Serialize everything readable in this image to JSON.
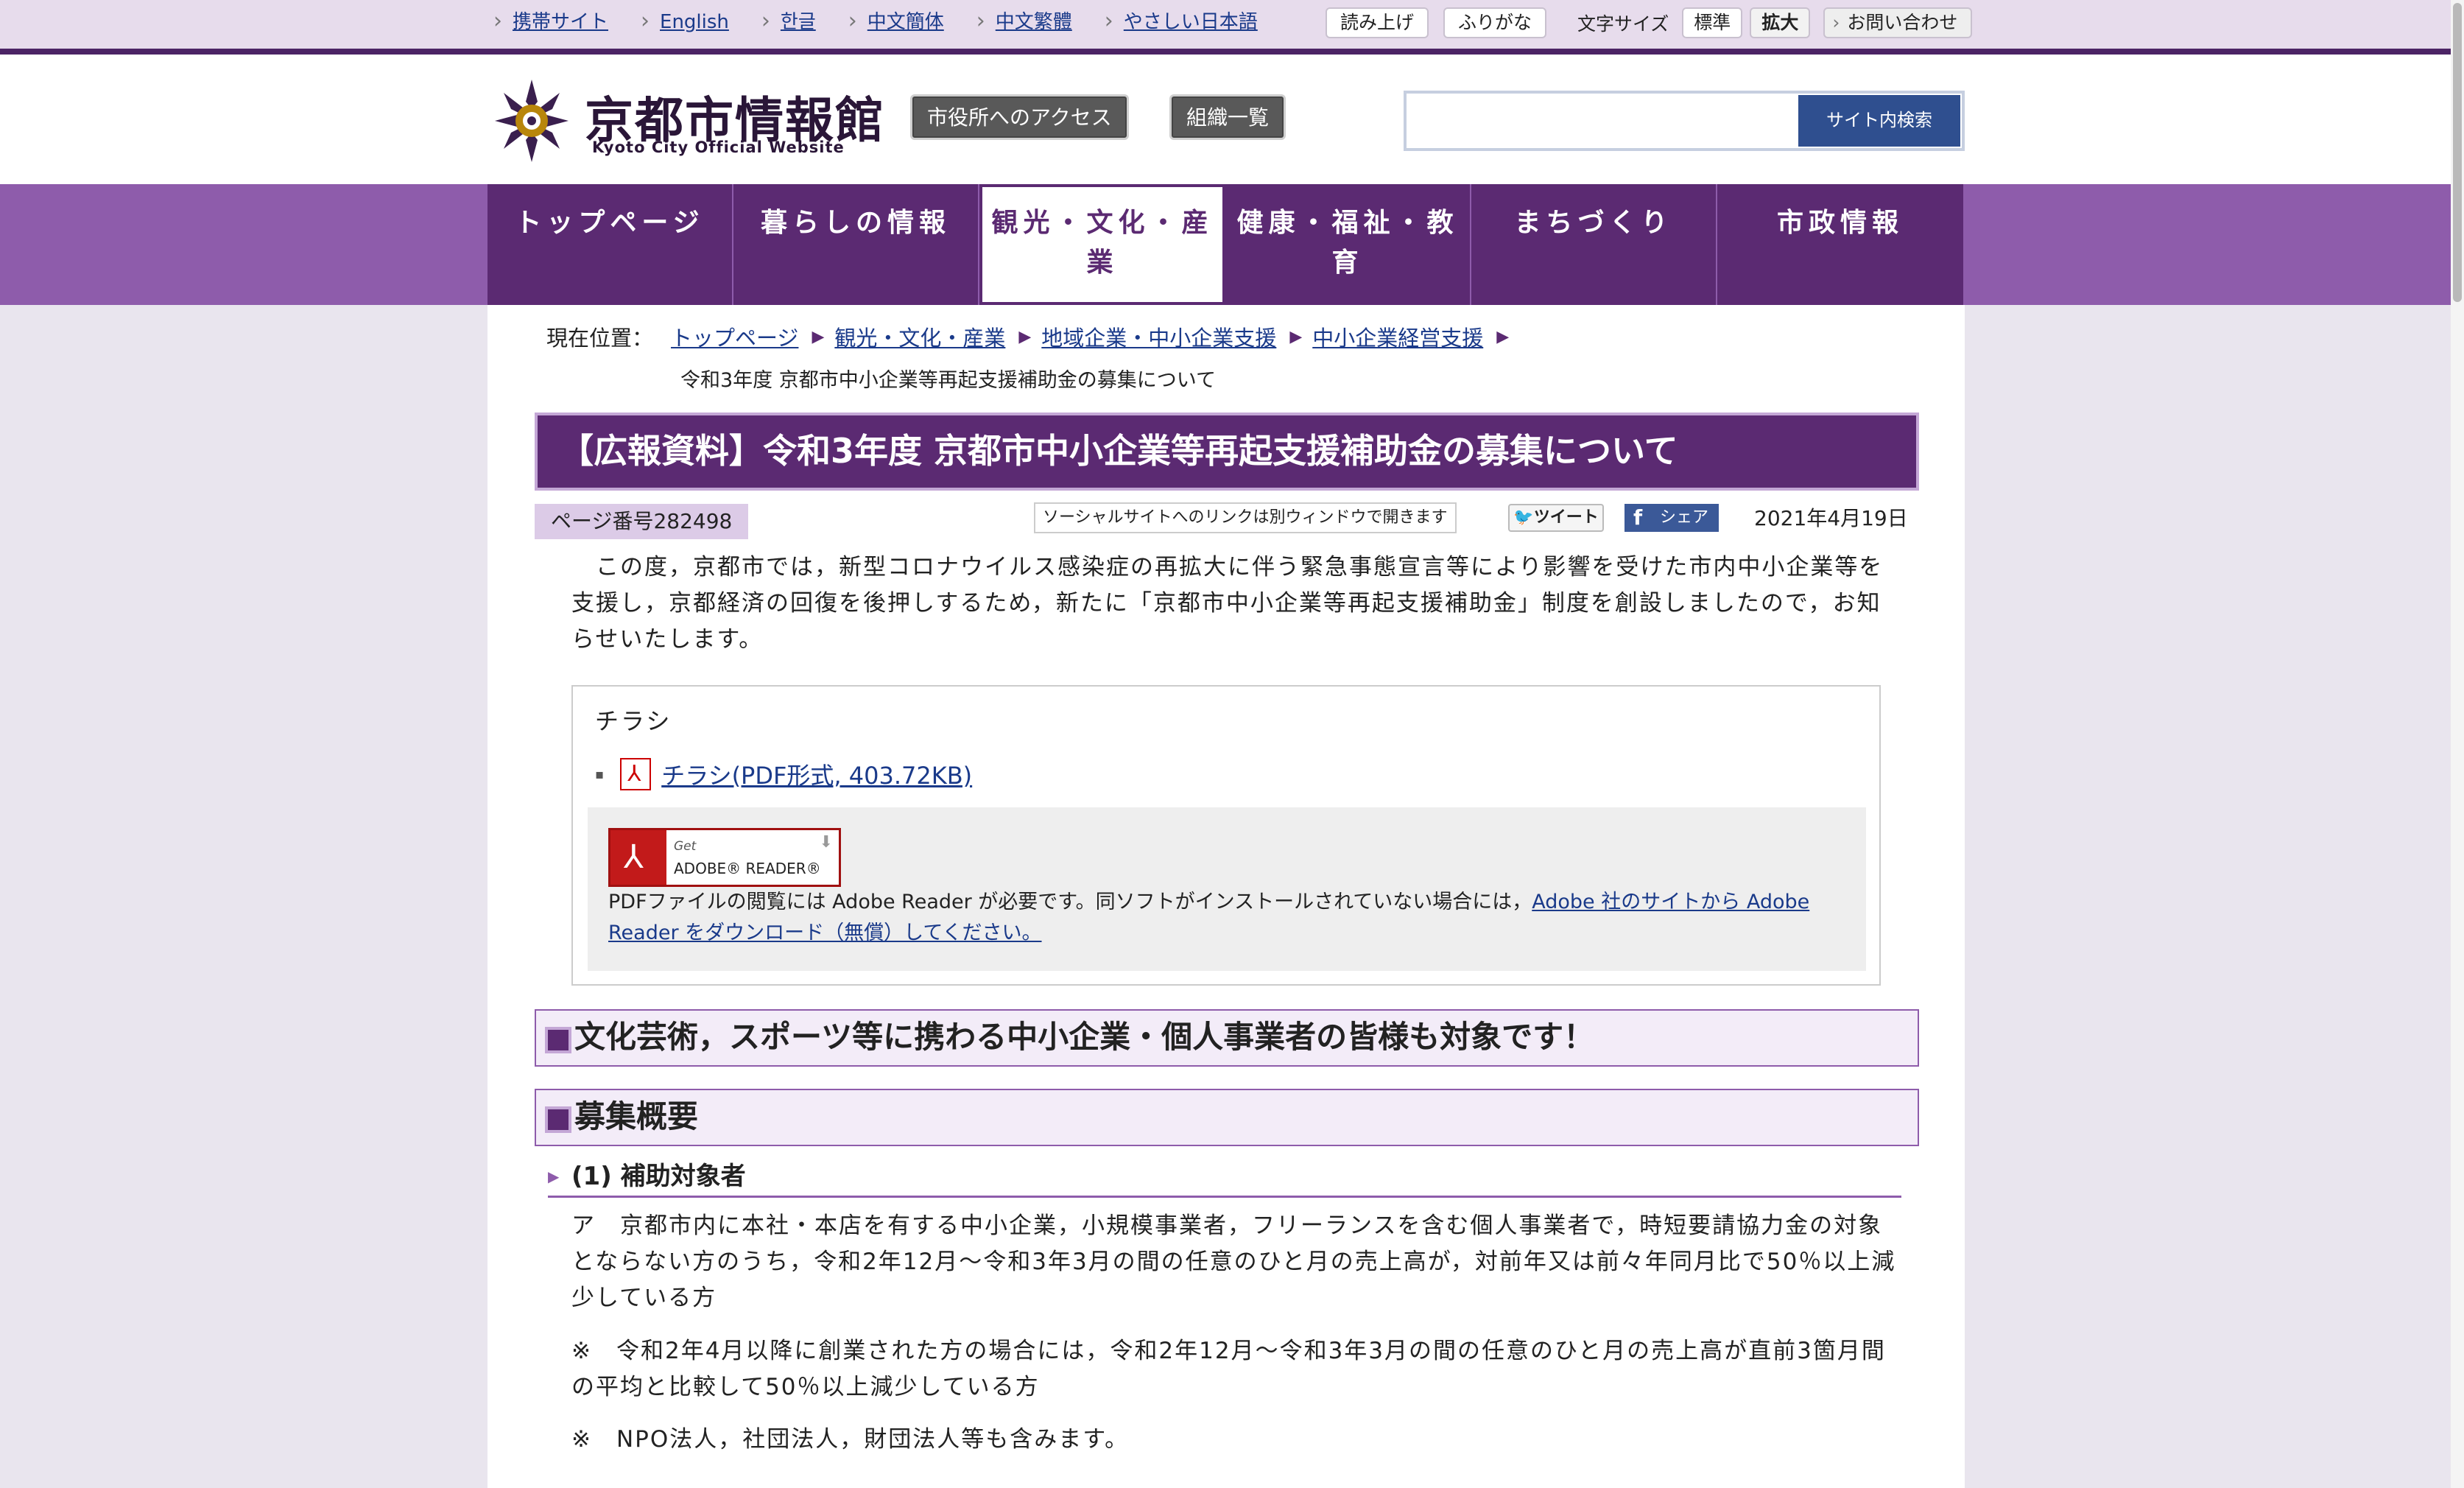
{
  "util": {
    "langs": [
      "携帯サイト",
      "English",
      "한글",
      "中文簡体",
      "中文繁體",
      "やさしい日本語"
    ],
    "read_aloud": "読み上げ",
    "furigana": "ふりがな",
    "font_size_label": "文字サイズ",
    "font_standard": "標準",
    "font_large": "拡大",
    "contact": "お問い合わせ"
  },
  "header": {
    "logo_title": "京都市情報館",
    "logo_sub": "Kyoto City Official Website",
    "access_btn": "市役所へのアクセス",
    "org_btn": "組織一覧",
    "search_placeholder": "",
    "search_btn": "サイト内検索"
  },
  "nav": [
    "トップページ",
    "暮らしの情報",
    "観光・文化・産業",
    "健康・福祉・教育",
    "まちづくり",
    "市政情報"
  ],
  "breadcrumb": {
    "label": "現在位置：",
    "links": [
      "トップページ",
      "観光・文化・産業",
      "地域企業・中小企業支援",
      "中小企業経営支援"
    ],
    "current": "令和3年度 京都市中小企業等再起支援補助金の募集について"
  },
  "article": {
    "title": "【広報資料】令和3年度 京都市中小企業等再起支援補助金の募集について",
    "page_no": "ページ番号282498",
    "social_note": "ソーシャルサイトへのリンクは別ウィンドウで開きます",
    "tweet": "ツイート",
    "share": "シェア",
    "date": "2021年4月19日",
    "intro": "　この度，京都市では，新型コロナウイルス感染症の再拡大に伴う緊急事態宣言等により影響を受けた市内中小企業等を支援し，京都経済の回復を後押しするため，新たに「京都市中小企業等再起支援補助金」制度を創設しましたので，お知らせいたします。"
  },
  "flyer": {
    "title": "チラシ",
    "link": "チラシ(PDF形式, 403.72KB)",
    "adobe_get": "Get",
    "adobe_reader": "ADOBE® READER®",
    "adobe_text_prefix": "PDFファイルの閲覧には Adobe Reader が必要です。同ソフトがインストールされていない場合には，",
    "adobe_link": "Adobe 社のサイトから Adobe Reader をダウンロード（無償）してください。"
  },
  "sections": {
    "h2_1": "文化芸術，スポーツ等に携わる中小企業・個人事業者の皆様も対象です！",
    "h2_2": "募集概要",
    "h3_1": "(1) 補助対象者",
    "p1": "ア　京都市内に本社・本店を有する中小企業，小規模事業者，フリーランスを含む個人事業者で，時短要請協力金の対象とならない方のうち，令和2年12月～令和3年3月の間の任意のひと月の売上高が，対前年又は前々年同月比で50％以上減少している方",
    "p2": "※　令和2年4月以降に創業された方の場合には，令和2年12月～令和3年3月の間の任意のひと月の売上高が直前3箇月間の平均と比較して50％以上減少している方",
    "p3": "※　NPO法人，社団法人，財団法人等も含みます。"
  }
}
